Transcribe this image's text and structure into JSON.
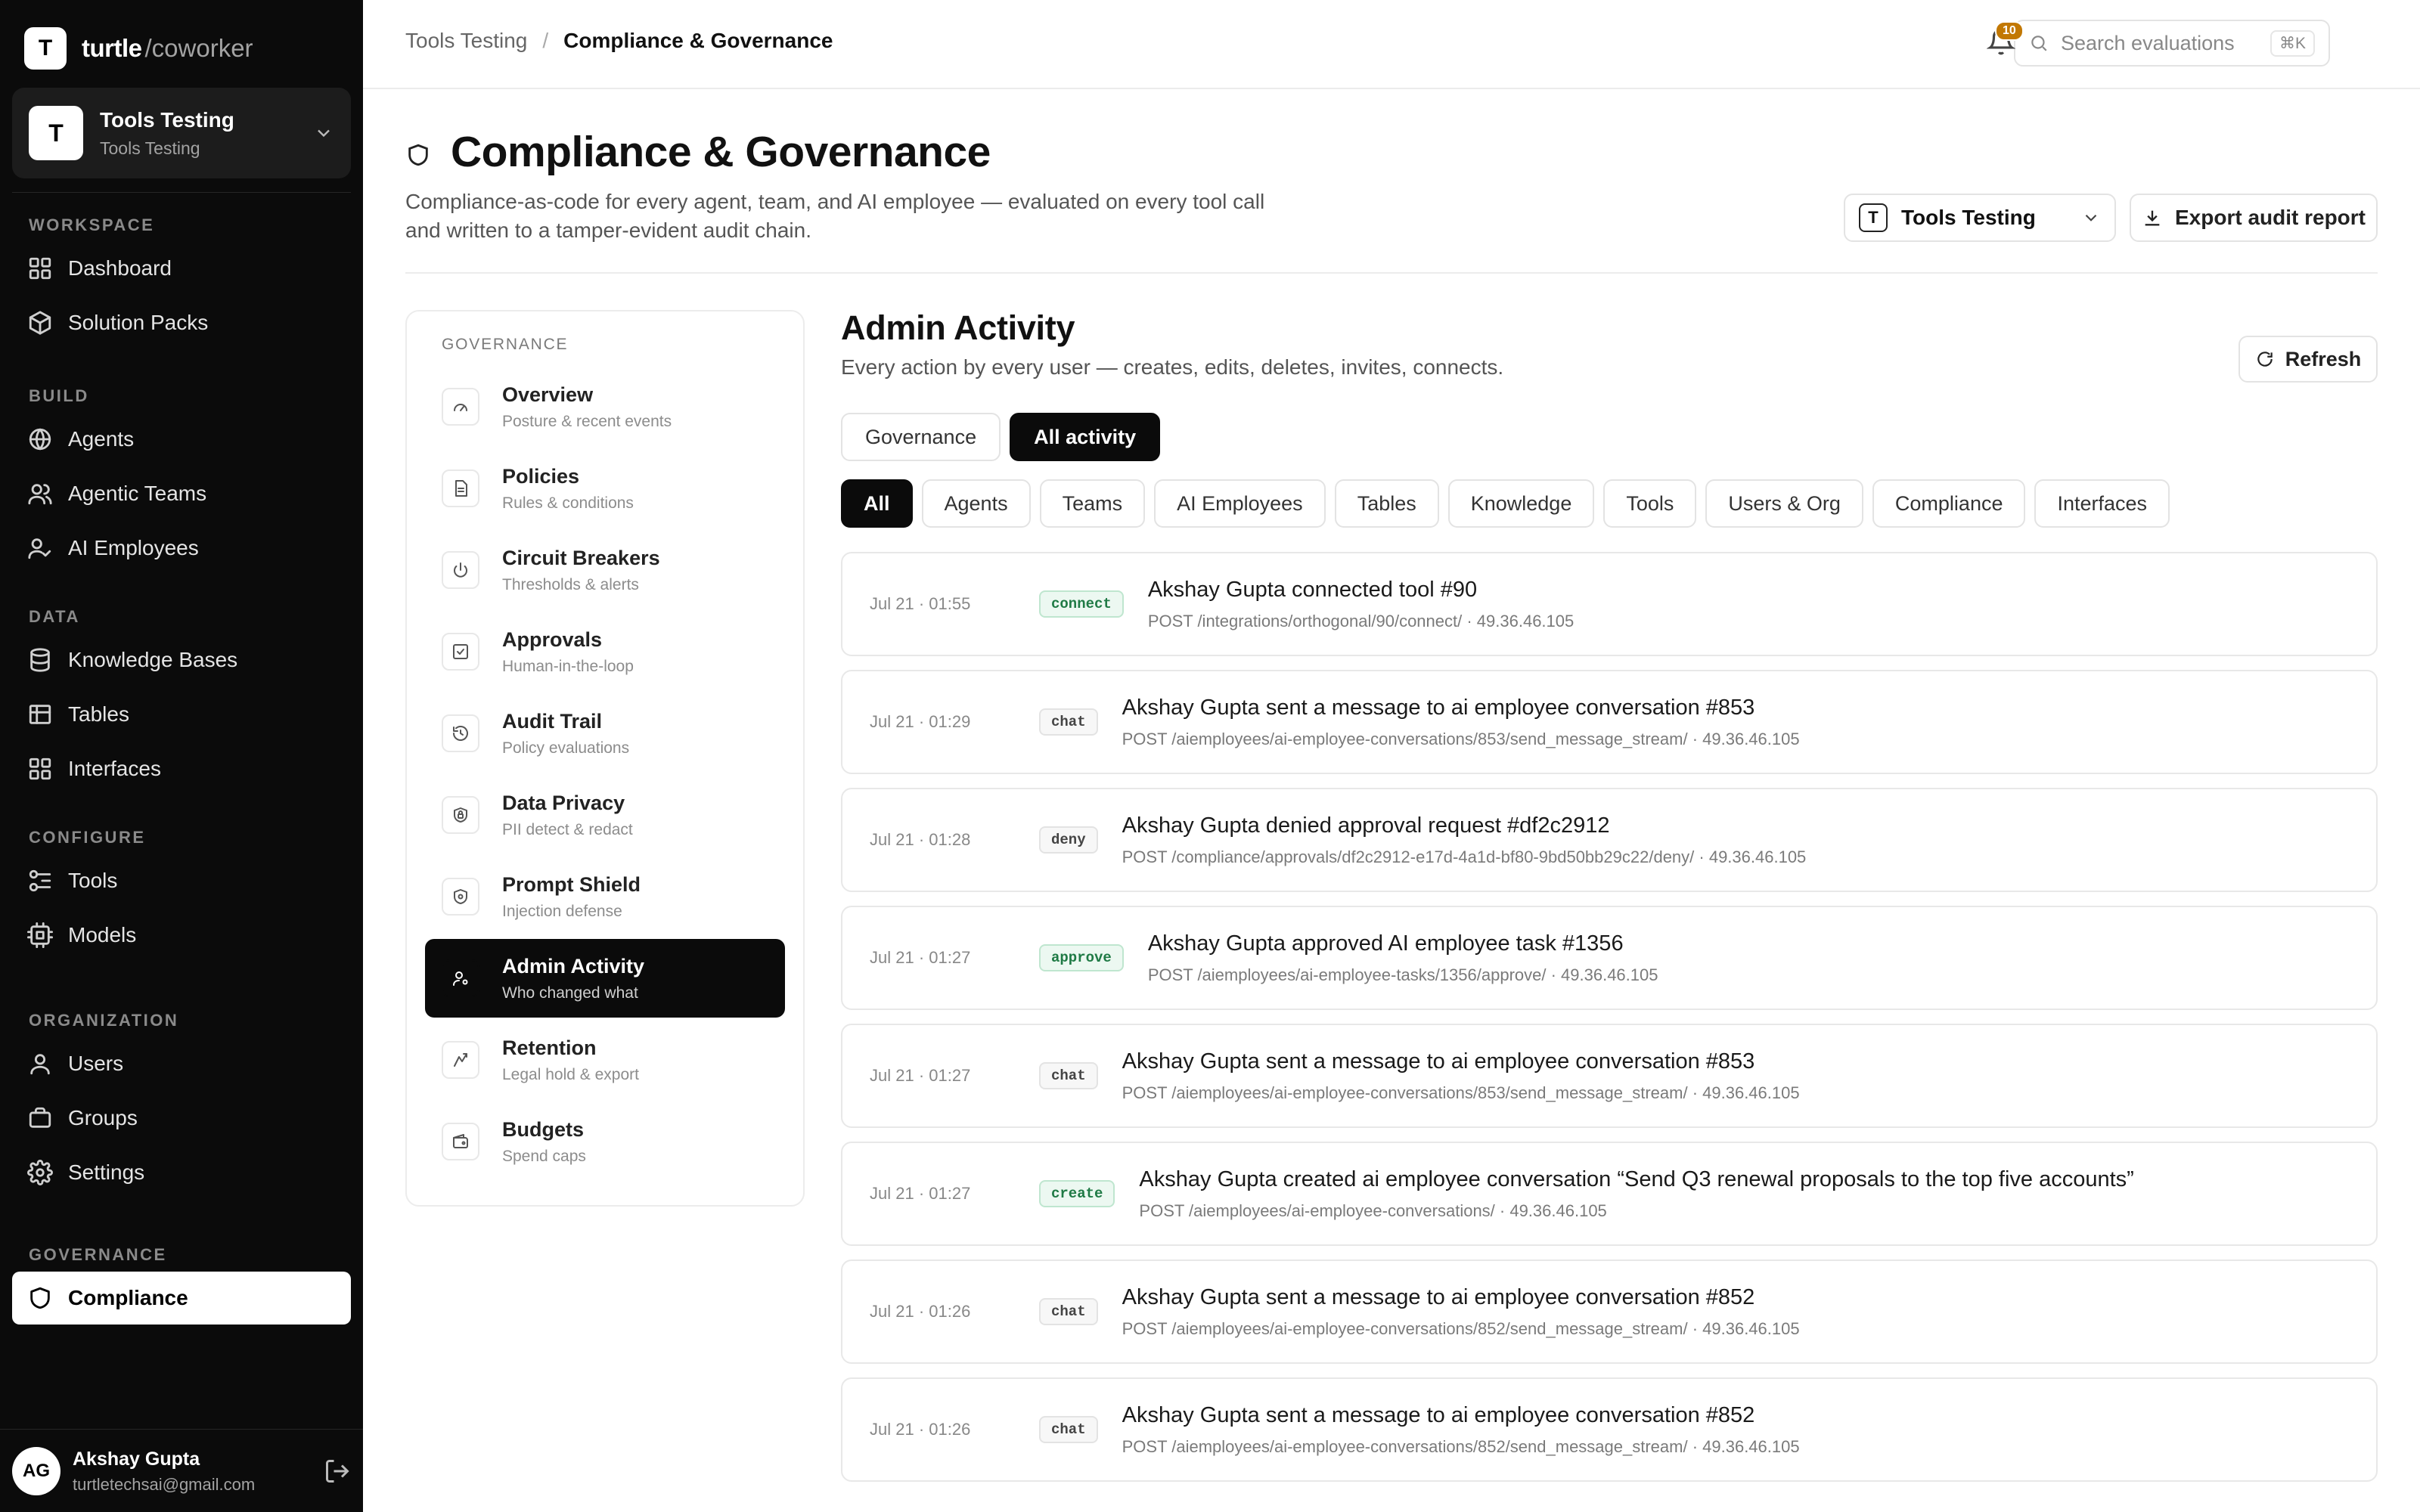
{
  "brand": {
    "logo_letter": "T",
    "name": "turtle",
    "suffix": "/coworker"
  },
  "workspace": {
    "avatar": "T",
    "name": "Tools Testing",
    "sub": "Tools Testing"
  },
  "sidebar": {
    "groups": [
      {
        "label": "WORKSPACE",
        "items": [
          {
            "label": "Dashboard",
            "icon": "grid-icon"
          },
          {
            "label": "Solution Packs",
            "icon": "package-icon"
          }
        ]
      },
      {
        "label": "BUILD",
        "items": [
          {
            "label": "Agents",
            "icon": "globe-icon"
          },
          {
            "label": "Agentic Teams",
            "icon": "users-icon"
          },
          {
            "label": "AI Employees",
            "icon": "user-check-icon"
          }
        ]
      },
      {
        "label": "DATA",
        "items": [
          {
            "label": "Knowledge Bases",
            "icon": "database-icon"
          },
          {
            "label": "Tables",
            "icon": "table-icon"
          },
          {
            "label": "Interfaces",
            "icon": "layout-icon"
          }
        ]
      },
      {
        "label": "CONFIGURE",
        "items": [
          {
            "label": "Tools",
            "icon": "tools-icon"
          },
          {
            "label": "Models",
            "icon": "models-icon"
          }
        ]
      },
      {
        "label": "ORGANIZATION",
        "items": [
          {
            "label": "Users",
            "icon": "user-icon"
          },
          {
            "label": "Groups",
            "icon": "groups-icon"
          },
          {
            "label": "Settings",
            "icon": "gear-icon"
          }
        ]
      },
      {
        "label": "GOVERNANCE",
        "items": [
          {
            "label": "Compliance",
            "icon": "shield-icon"
          }
        ]
      }
    ]
  },
  "user": {
    "initials": "AG",
    "name": "Akshay Gupta",
    "email": "turtletechsai@gmail.com"
  },
  "header": {
    "crumb_root": "Tools Testing",
    "crumb_current": "Compliance & Governance",
    "search_placeholder": "Search evaluations",
    "search_shortcut": "⌘K",
    "notifications": "10"
  },
  "page": {
    "title": "Compliance & Governance",
    "description": "Compliance-as-code for every agent, team, and AI employee — evaluated on every tool call and written to a tamper-evident audit chain.",
    "workspace_select": {
      "letter": "T",
      "label": "Tools Testing"
    },
    "export_label": "Export audit report"
  },
  "gov_nav": {
    "label": "GOVERNANCE",
    "items": [
      {
        "title": "Overview",
        "sub": "Posture & recent events",
        "icon": "gauge-icon"
      },
      {
        "title": "Policies",
        "sub": "Rules & conditions",
        "icon": "document-icon"
      },
      {
        "title": "Circuit Breakers",
        "sub": "Thresholds & alerts",
        "icon": "power-icon"
      },
      {
        "title": "Approvals",
        "sub": "Human-in-the-loop",
        "icon": "checkbox-icon"
      },
      {
        "title": "Audit Trail",
        "sub": "Policy evaluations",
        "icon": "history-icon"
      },
      {
        "title": "Data Privacy",
        "sub": "PII detect & redact",
        "icon": "lock-shield-icon"
      },
      {
        "title": "Prompt Shield",
        "sub": "Injection defense",
        "icon": "shield-dot-icon"
      },
      {
        "title": "Admin Activity",
        "sub": "Who changed what",
        "icon": "user-cog-icon"
      },
      {
        "title": "Retention",
        "sub": "Legal hold & export",
        "icon": "archive-icon"
      },
      {
        "title": "Budgets",
        "sub": "Spend caps",
        "icon": "wallet-icon"
      }
    ]
  },
  "section": {
    "title": "Admin Activity",
    "description": "Every action by every user — creates, edits, deletes, invites, connects.",
    "refresh_label": "Refresh",
    "views": [
      "Governance",
      "All activity"
    ],
    "filters": [
      "All",
      "Agents",
      "Teams",
      "AI Employees",
      "Tables",
      "Knowledge",
      "Tools",
      "Users & Org",
      "Compliance",
      "Interfaces"
    ]
  },
  "events": [
    {
      "time": "Jul 21 · 01:55",
      "badge": "connect",
      "title": "Akshay Gupta connected tool #90",
      "meta": "POST /integrations/orthogonal/90/connect/ · 49.36.46.105"
    },
    {
      "time": "Jul 21 · 01:29",
      "badge": "chat",
      "title": "Akshay Gupta sent a message to ai employee conversation #853",
      "meta": "POST /aiemployees/ai-employee-conversations/853/send_message_stream/ · 49.36.46.105"
    },
    {
      "time": "Jul 21 · 01:28",
      "badge": "deny",
      "title": "Akshay Gupta denied approval request #df2c2912",
      "meta": "POST /compliance/approvals/df2c2912-e17d-4a1d-bf80-9bd50bb29c22/deny/ · 49.36.46.105"
    },
    {
      "time": "Jul 21 · 01:27",
      "badge": "approve",
      "title": "Akshay Gupta approved AI employee task #1356",
      "meta": "POST /aiemployees/ai-employee-tasks/1356/approve/ · 49.36.46.105"
    },
    {
      "time": "Jul 21 · 01:27",
      "badge": "chat",
      "title": "Akshay Gupta sent a message to ai employee conversation #853",
      "meta": "POST /aiemployees/ai-employee-conversations/853/send_message_stream/ · 49.36.46.105"
    },
    {
      "time": "Jul 21 · 01:27",
      "badge": "create",
      "title": "Akshay Gupta created ai employee conversation “Send Q3 renewal proposals to the top five accounts”",
      "meta": "POST /aiemployees/ai-employee-conversations/ · 49.36.46.105"
    },
    {
      "time": "Jul 21 · 01:26",
      "badge": "chat",
      "title": "Akshay Gupta sent a message to ai employee conversation #852",
      "meta": "POST /aiemployees/ai-employee-conversations/852/send_message_stream/ · 49.36.46.105"
    },
    {
      "time": "Jul 21 · 01:26",
      "badge": "chat",
      "title": "Akshay Gupta sent a message to ai employee conversation #852",
      "meta": "POST /aiemployees/ai-employee-conversations/852/send_message_stream/ · 49.36.46.105"
    }
  ]
}
